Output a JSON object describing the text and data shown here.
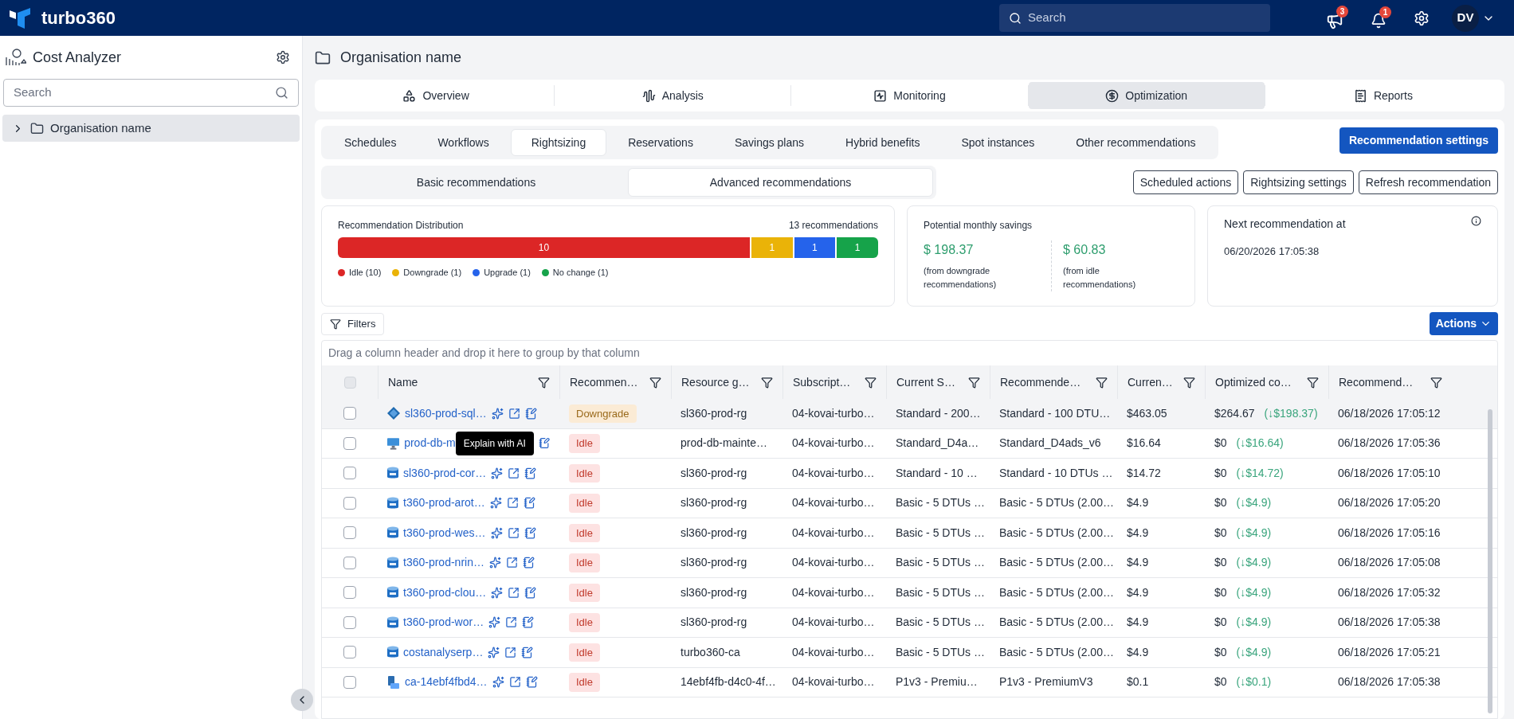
{
  "app": {
    "name": "turbo360",
    "search_placeholder": "Search",
    "announcements_badge": "3",
    "notifications_badge": "1",
    "avatar": "DV"
  },
  "sidebar": {
    "title": "Cost Analyzer",
    "search_placeholder": "Search",
    "items": [
      {
        "label": "Organisation name",
        "selected": true,
        "expanded": false
      }
    ]
  },
  "page": {
    "title": "Organisation name"
  },
  "main_tabs": [
    {
      "label": "Overview",
      "selected": false
    },
    {
      "label": "Analysis",
      "selected": false
    },
    {
      "label": "Monitoring",
      "selected": false
    },
    {
      "label": "Optimization",
      "selected": true
    },
    {
      "label": "Reports",
      "selected": false
    }
  ],
  "sub_tabs": [
    {
      "label": "Schedules",
      "selected": false
    },
    {
      "label": "Workflows",
      "selected": false
    },
    {
      "label": "Rightsizing",
      "selected": true
    },
    {
      "label": "Reservations",
      "selected": false
    },
    {
      "label": "Savings plans",
      "selected": false
    },
    {
      "label": "Hybrid benefits",
      "selected": false
    },
    {
      "label": "Spot instances",
      "selected": false
    },
    {
      "label": "Other recommendations",
      "selected": false
    }
  ],
  "recommendation_settings_button": "Recommendation settings",
  "mode_tabs": [
    {
      "label": "Basic recommendations",
      "selected": false
    },
    {
      "label": "Advanced recommendations",
      "selected": true
    }
  ],
  "action_buttons": [
    "Scheduled actions",
    "Rightsizing settings",
    "Refresh recommendation"
  ],
  "distribution": {
    "title": "Recommendation Distribution",
    "total": "13 recommendations",
    "segments": [
      {
        "label": "10",
        "color": "#dc2626"
      },
      {
        "label": "1",
        "color": "#eab308"
      },
      {
        "label": "1",
        "color": "#2563eb"
      },
      {
        "label": "1",
        "color": "#16a34a"
      }
    ],
    "legend": [
      {
        "label": "Idle (10)",
        "color": "#dc2626"
      },
      {
        "label": "Downgrade (1)",
        "color": "#eab308"
      },
      {
        "label": "Upgrade (1)",
        "color": "#2563eb"
      },
      {
        "label": "No change (1)",
        "color": "#16a34a"
      }
    ]
  },
  "savings": {
    "title": "Potential monthly savings",
    "items": [
      {
        "amount": "$ 198.37",
        "note": "(from downgrade recommendations)"
      },
      {
        "amount": "$ 60.83",
        "note": "(from idle recommendations)"
      }
    ]
  },
  "next": {
    "title": "Next recommendation at",
    "value": "06/20/2026 17:05:38"
  },
  "filters_button": "Filters",
  "actions_button": "Actions",
  "group_hint": "Drag a column header and drop it here to group by that column",
  "table": {
    "select_all_checked": false,
    "columns": [
      "Name",
      "Recommen…",
      "Resource g…",
      "Subscript…",
      "Current S…",
      "Recommende…",
      "Curren…",
      "Optimized co…",
      "Recommend…"
    ],
    "rows": [
      {
        "kind": "diamond",
        "name": "sl360-prod-sql…",
        "badge": {
          "label": "Downgrade",
          "kind": "downgrade"
        },
        "group": "sl360-prod-rg",
        "subscription": "04-kovai-turbo…",
        "current_sku": "Standard - 200…",
        "recommended_sku": "Standard - 100 DTU…",
        "current_cost": "$463.05",
        "optimized_cost": "$264.67",
        "saving": "(↓$198.37)",
        "date": "06/18/2026 17:05:12",
        "selected": true,
        "checked": false
      },
      {
        "kind": "vm",
        "name": "prod-db-m",
        "tooltip": "Explain with AI",
        "badge": {
          "label": "Idle",
          "kind": "idle"
        },
        "group": "prod-db-mainte…",
        "subscription": "04-kovai-turbo…",
        "current_sku": "Standard_D4a…",
        "recommended_sku": "Standard_D4ads_v6",
        "current_cost": "$16.64",
        "optimized_cost": "$0",
        "saving": "(↓$16.64)",
        "date": "06/18/2026 17:05:36",
        "selected": false,
        "checked": false
      },
      {
        "kind": "sql",
        "name": "sl360-prod-cor…",
        "badge": {
          "label": "Idle",
          "kind": "idle"
        },
        "group": "sl360-prod-rg",
        "subscription": "04-kovai-turbo…",
        "current_sku": "Standard - 10 …",
        "recommended_sku": "Standard - 10 DTUs …",
        "current_cost": "$14.72",
        "optimized_cost": "$0",
        "saving": "(↓$14.72)",
        "date": "06/18/2026 17:05:10",
        "selected": false,
        "checked": false
      },
      {
        "kind": "sql",
        "name": "t360-prod-arot…",
        "badge": {
          "label": "Idle",
          "kind": "idle"
        },
        "group": "sl360-prod-rg",
        "subscription": "04-kovai-turbo…",
        "current_sku": "Basic - 5 DTUs …",
        "recommended_sku": "Basic - 5 DTUs (2.00…",
        "current_cost": "$4.9",
        "optimized_cost": "$0",
        "saving": "(↓$4.9)",
        "date": "06/18/2026 17:05:20",
        "selected": false,
        "checked": false
      },
      {
        "kind": "sql",
        "name": "t360-prod-wes…",
        "badge": {
          "label": "Idle",
          "kind": "idle"
        },
        "group": "sl360-prod-rg",
        "subscription": "04-kovai-turbo…",
        "current_sku": "Basic - 5 DTUs …",
        "recommended_sku": "Basic - 5 DTUs (2.00…",
        "current_cost": "$4.9",
        "optimized_cost": "$0",
        "saving": "(↓$4.9)",
        "date": "06/18/2026 17:05:16",
        "selected": false,
        "checked": false
      },
      {
        "kind": "sql",
        "name": "t360-prod-nrin…",
        "badge": {
          "label": "Idle",
          "kind": "idle"
        },
        "group": "sl360-prod-rg",
        "subscription": "04-kovai-turbo…",
        "current_sku": "Basic - 5 DTUs …",
        "recommended_sku": "Basic - 5 DTUs (2.00…",
        "current_cost": "$4.9",
        "optimized_cost": "$0",
        "saving": "(↓$4.9)",
        "date": "06/18/2026 17:05:08",
        "selected": false,
        "checked": false
      },
      {
        "kind": "sql",
        "name": "t360-prod-clou…",
        "badge": {
          "label": "Idle",
          "kind": "idle"
        },
        "group": "sl360-prod-rg",
        "subscription": "04-kovai-turbo…",
        "current_sku": "Basic - 5 DTUs …",
        "recommended_sku": "Basic - 5 DTUs (2.00…",
        "current_cost": "$4.9",
        "optimized_cost": "$0",
        "saving": "(↓$4.9)",
        "date": "06/18/2026 17:05:32",
        "selected": false,
        "checked": false
      },
      {
        "kind": "sql",
        "name": "t360-prod-wor…",
        "badge": {
          "label": "Idle",
          "kind": "idle"
        },
        "group": "sl360-prod-rg",
        "subscription": "04-kovai-turbo…",
        "current_sku": "Basic - 5 DTUs …",
        "recommended_sku": "Basic - 5 DTUs (2.00…",
        "current_cost": "$4.9",
        "optimized_cost": "$0",
        "saving": "(↓$4.9)",
        "date": "06/18/2026 17:05:38",
        "selected": false,
        "checked": false
      },
      {
        "kind": "sql",
        "name": "costanalyserp…",
        "badge": {
          "label": "Idle",
          "kind": "idle"
        },
        "group": "turbo360-ca",
        "subscription": "04-kovai-turbo…",
        "current_sku": "Basic - 5 DTUs …",
        "recommended_sku": "Basic - 5 DTUs (2.00…",
        "current_cost": "$4.9",
        "optimized_cost": "$0",
        "saving": "(↓$4.9)",
        "date": "06/18/2026 17:05:21",
        "selected": false,
        "checked": false
      },
      {
        "kind": "app",
        "name": "ca-14ebf4fbd4…",
        "badge": {
          "label": "Idle",
          "kind": "idle"
        },
        "group": "14ebf4fb-d4c0-4f…",
        "subscription": "04-kovai-turbo…",
        "current_sku": "P1v3 - Premiu…",
        "recommended_sku": "P1v3 - PremiumV3",
        "current_cost": "$0.1",
        "optimized_cost": "$0",
        "saving": "(↓$0.1)",
        "date": "06/18/2026 17:05:38",
        "selected": false,
        "checked": false
      }
    ]
  }
}
